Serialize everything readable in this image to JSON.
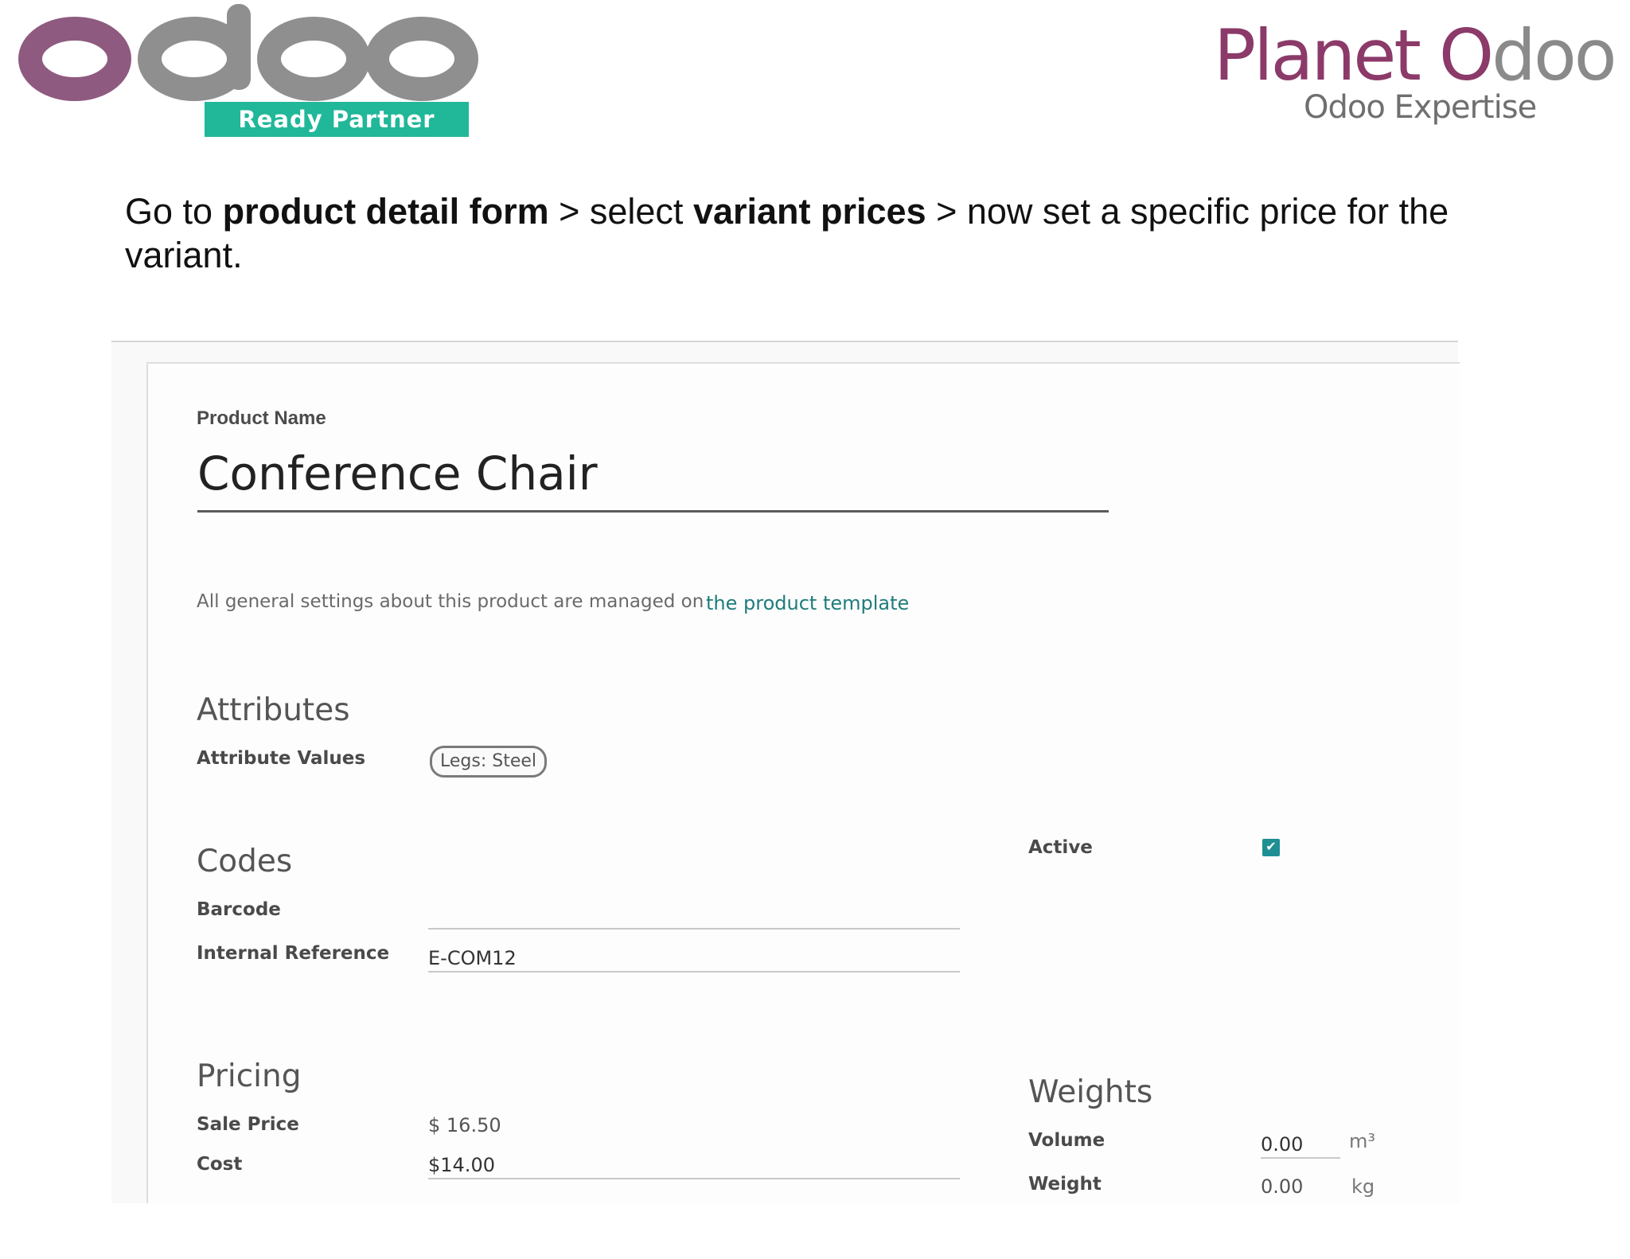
{
  "header": {
    "left_logo_badge": "Ready Partner",
    "right_logo": {
      "title_part1": "Planet ",
      "title_part2": "O",
      "title_part3": "doo",
      "subtitle": "Odoo Expertise"
    },
    "brand_colors": {
      "odoo_purple": "#8f5a80",
      "odoo_grey": "#8f8f8f",
      "badge_green": "#21b799",
      "planet_purple": "#8b3a69"
    }
  },
  "instruction": {
    "t1": "Go to ",
    "b1": "product detail form",
    "t2": " > select ",
    "b2": "variant prices",
    "t3": " > now set a specific price for the variant."
  },
  "form": {
    "product_name_label": "Product Name",
    "product_name": "Conference Chair",
    "note": "All general settings about this product are managed on",
    "template_link": "the product template",
    "attributes": {
      "title": "Attributes",
      "values_label": "Attribute Values",
      "tag": "Legs: Steel"
    },
    "codes": {
      "title": "Codes",
      "barcode_label": "Barcode",
      "barcode_value": "",
      "internal_ref_label": "Internal Reference",
      "internal_ref_value": "E-COM12"
    },
    "active": {
      "label": "Active",
      "checked": true
    },
    "pricing": {
      "title": "Pricing",
      "sale_price_label": "Sale Price",
      "sale_price_value": "$ 16.50",
      "cost_label": "Cost",
      "cost_value": "$14.00"
    },
    "weights": {
      "title": "Weights",
      "volume_label": "Volume",
      "volume_value": "0.00",
      "volume_unit": "m³",
      "weight_label": "Weight",
      "weight_value": "0.00",
      "weight_unit": "kg"
    },
    "accent_color": "#1f8f94"
  }
}
